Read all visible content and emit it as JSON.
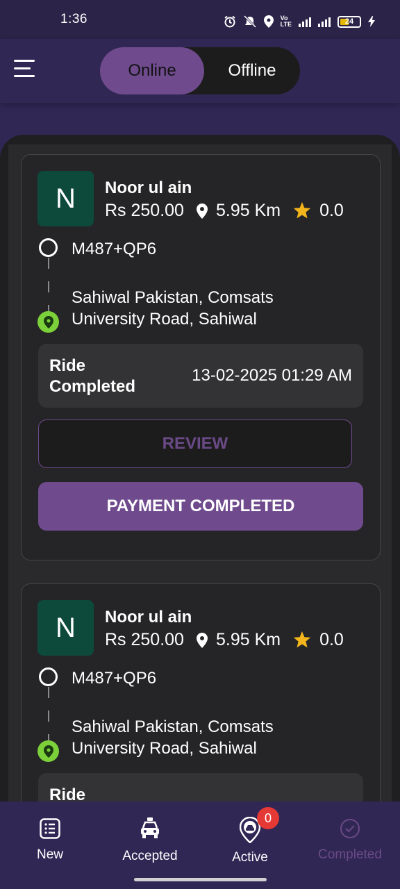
{
  "status_bar": {
    "time": "1:36",
    "battery": "24"
  },
  "header": {
    "toggle": {
      "online": "Online",
      "offline": "Offline",
      "selected": "Online"
    }
  },
  "rides": [
    {
      "avatar_letter": "N",
      "name": "Noor ul ain",
      "fare": "Rs 250.00",
      "distance": "5.95 Km",
      "rating": "0.0",
      "pickup": "M487+QP6",
      "dropoff": "Sahiwal Pakistan, Comsats University Road, Sahiwal",
      "status_label": "Ride Completed",
      "status_date": "13-02-2025 01:29 AM",
      "review_label": "REVIEW",
      "payment_label": "PAYMENT COMPLETED"
    },
    {
      "avatar_letter": "N",
      "name": "Noor ul ain",
      "fare": "Rs 250.00",
      "distance": "5.95 Km",
      "rating": "0.0",
      "pickup": "M487+QP6",
      "dropoff": "Sahiwal Pakistan, Comsats University Road, Sahiwal",
      "status_label": "Ride"
    }
  ],
  "bottom_nav": {
    "items": [
      {
        "label": "New",
        "icon": "list-icon"
      },
      {
        "label": "Accepted",
        "icon": "car-icon"
      },
      {
        "label": "Active",
        "icon": "car-pin-icon",
        "badge": "0"
      },
      {
        "label": "Completed",
        "icon": "check-circle-icon"
      }
    ]
  },
  "colors": {
    "accent": "#6f4b8e",
    "background": "#312755",
    "card": "#252527",
    "avatar": "#0d4a3c",
    "star": "#f2b51c",
    "dropoff_pin": "#7cd13a",
    "badge": "#e53935"
  }
}
